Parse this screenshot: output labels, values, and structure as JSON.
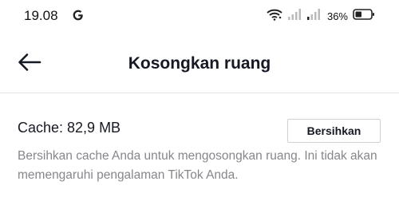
{
  "status_bar": {
    "time": "19.08",
    "battery_percent": "36%",
    "icons": [
      "google-g-icon",
      "wifi-icon",
      "signal-icon",
      "signal-icon",
      "battery-icon"
    ]
  },
  "header": {
    "title": "Kosongkan ruang",
    "back_icon": "arrow-left-icon"
  },
  "cache": {
    "label": "Cache: 82,9 MB",
    "clear_button": "Bersihkan",
    "description": "Bersihkan cache Anda untuk mengosongkan ruang. Ini tidak akan memengaruhi pengalaman TikTok Anda."
  },
  "colors": {
    "text_primary": "#161823",
    "text_secondary": "#86878b",
    "divider": "#e3e3e4",
    "button_border": "#d0d0d3"
  }
}
